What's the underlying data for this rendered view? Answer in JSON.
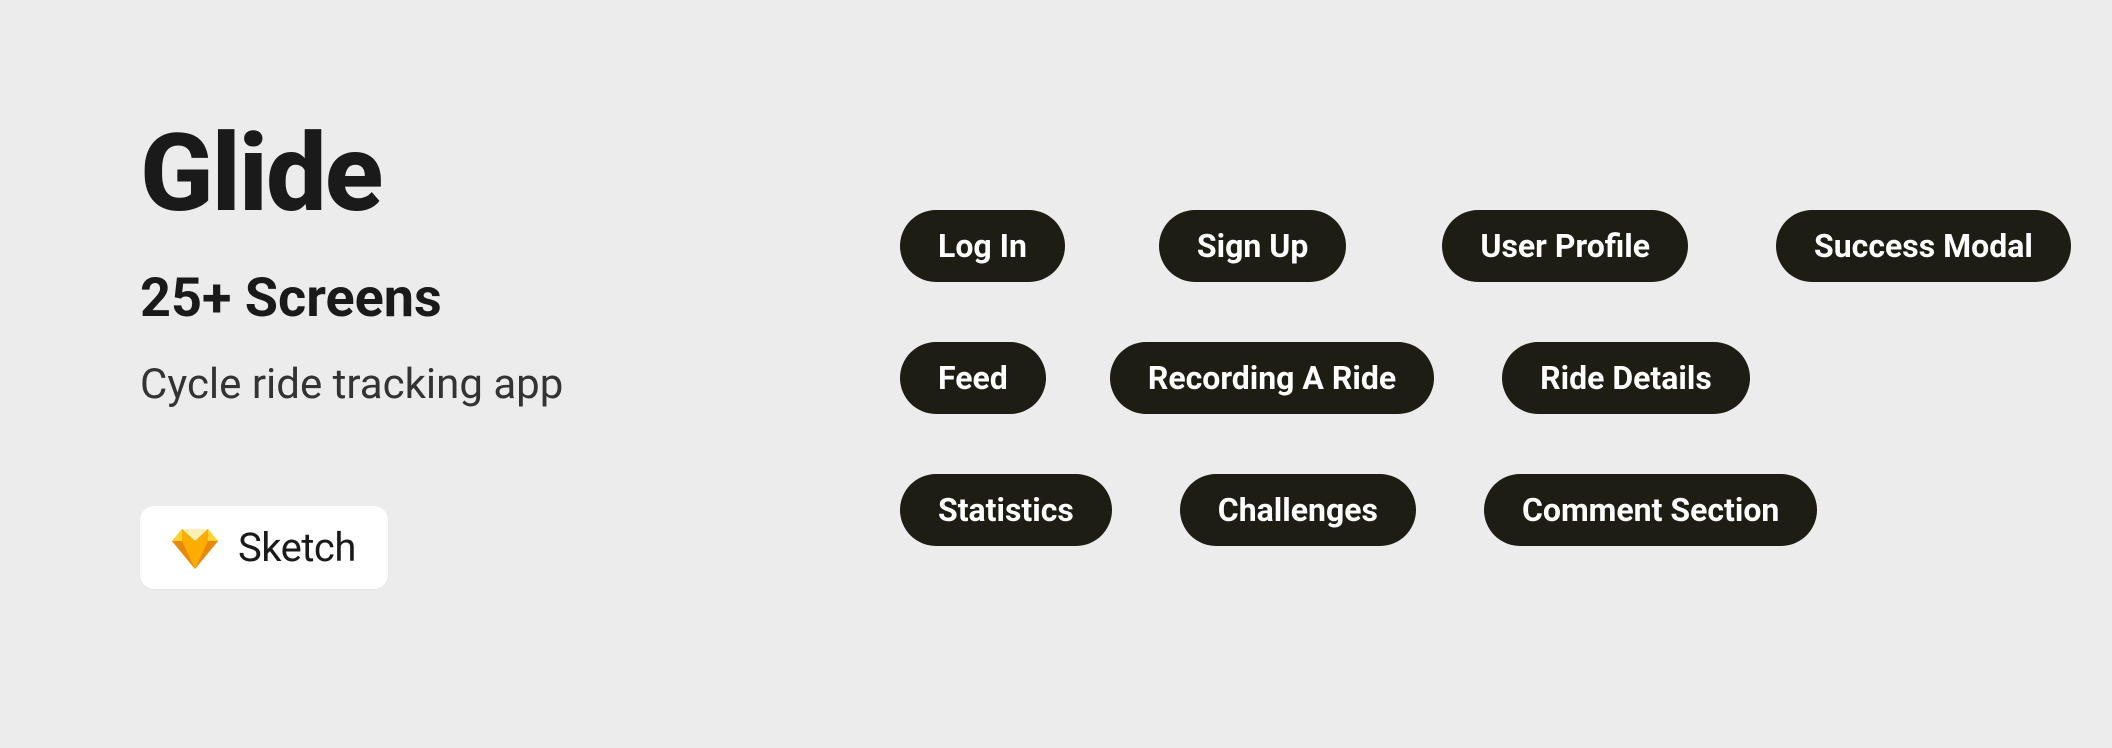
{
  "left": {
    "title": "Glide",
    "subtitle": "25+ Screens",
    "description": "Cycle ride tracking app",
    "badge_label": "Sketch"
  },
  "pills": {
    "row1": [
      "Log In",
      "Sign Up",
      "User Profile",
      "Success Modal"
    ],
    "row2": [
      "Feed",
      "Recording A Ride",
      "Ride Details"
    ],
    "row3": [
      "Statistics",
      "Challenges",
      "Comment Section"
    ]
  },
  "layout": {
    "row1_gaps": [
      94,
      96,
      88
    ],
    "row2_gaps": [
      64,
      68
    ],
    "row3_gaps": [
      68,
      68
    ]
  }
}
